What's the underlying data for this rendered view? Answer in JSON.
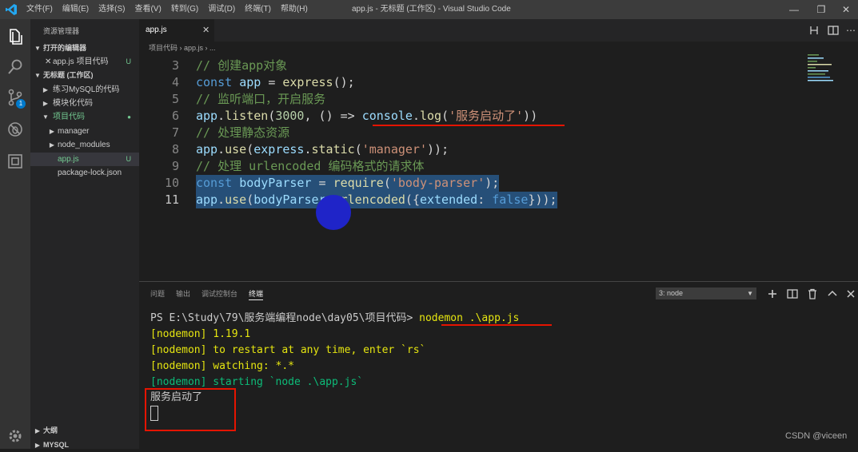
{
  "titlebar": {
    "menu": [
      "文件(F)",
      "编辑(E)",
      "选择(S)",
      "查看(V)",
      "转到(G)",
      "调试(D)",
      "终端(T)",
      "帮助(H)"
    ],
    "title": "app.js - 无标题 (工作区) - Visual Studio Code",
    "minimize": "—",
    "maximize": "❐",
    "close": "✕"
  },
  "activity": {
    "scm_badge": "1"
  },
  "sidebar": {
    "title": "资源管理器",
    "open_editors": "打开的编辑器",
    "open_file": "app.js 项目代码",
    "open_file_status": "U",
    "workspace": "无标题 (工作区)",
    "folders": [
      "练习MySQL的代码",
      "模块化代码",
      "项目代码"
    ],
    "project_items": [
      "manager",
      "node_modules",
      "app.js",
      "package-lock.json"
    ],
    "appjs_status": "U",
    "outline": "大纲",
    "mysql": "MYSQL"
  },
  "editor": {
    "tab": "app.js",
    "breadcrumb": "项目代码 › app.js › ...",
    "lines": [
      {
        "n": "3",
        "code": "// 创建app对象"
      },
      {
        "n": "4",
        "code": "const app = express();"
      },
      {
        "n": "5",
        "code": "// 监听端口，开启服务"
      },
      {
        "n": "6",
        "code": "app.listen(3000, () => console.log('服务启动了'))"
      },
      {
        "n": "7",
        "code": "// 处理静态资源"
      },
      {
        "n": "8",
        "code": "app.use(express.static('manager'));"
      },
      {
        "n": "9",
        "code": "// 处理 urlencoded 编码格式的请求体"
      },
      {
        "n": "10",
        "code": "const bodyParser = require('body-parser');"
      },
      {
        "n": "11",
        "code": "app.use(bodyParser.urlencoded({extended: false}));"
      }
    ]
  },
  "panel": {
    "tabs": [
      "问题",
      "输出",
      "调试控制台",
      "终端"
    ],
    "terminal_select": "3: node",
    "prompt": "PS E:\\Study\\79\\服务端编程node\\day05\\项目代码> ",
    "command": "nodemon .\\app.js",
    "output": [
      "[nodemon] 1.19.1",
      "[nodemon] to restart at any time, enter `rs`",
      "[nodemon] watching: *.*",
      "[nodemon] starting `node .\\app.js`",
      "服务启动了"
    ]
  },
  "watermark": "CSDN @viceen",
  "colors": {
    "accent_blue": "#007acc",
    "annotation_red": "#e51400",
    "cursor_highlight": "#1f24c8"
  }
}
